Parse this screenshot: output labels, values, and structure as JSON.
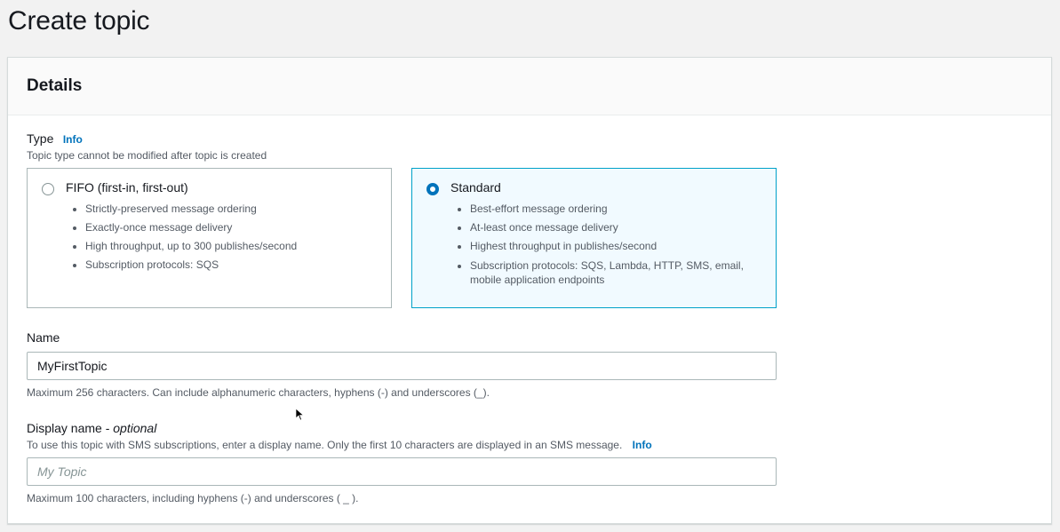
{
  "page": {
    "title": "Create topic"
  },
  "details": {
    "title": "Details",
    "type": {
      "label": "Type",
      "info": "Info",
      "description": "Topic type cannot be modified after topic is created",
      "options": [
        {
          "title": "FIFO (first-in, first-out)",
          "selected": false,
          "bullets": [
            "Strictly-preserved message ordering",
            "Exactly-once message delivery",
            "High throughput, up to 300 publishes/second",
            "Subscription protocols: SQS"
          ]
        },
        {
          "title": "Standard",
          "selected": true,
          "bullets": [
            "Best-effort message ordering",
            "At-least once message delivery",
            "Highest throughput in publishes/second",
            "Subscription protocols: SQS, Lambda, HTTP, SMS, email, mobile application endpoints"
          ]
        }
      ]
    },
    "name": {
      "label": "Name",
      "value": "MyFirstTopic",
      "hint": "Maximum 256 characters. Can include alphanumeric characters, hyphens (-) and underscores (_)."
    },
    "display_name": {
      "label": "Display name - ",
      "label_optional": "optional",
      "description": "To use this topic with SMS subscriptions, enter a display name. Only the first 10 characters are displayed in an SMS message.",
      "info": "Info",
      "placeholder": "My Topic",
      "value": "",
      "hint": "Maximum 100 characters, including hyphens (-) and underscores ( _ )."
    }
  },
  "colors": {
    "accent": "#0073bb",
    "selected_bg": "#f1faff",
    "selected_border": "#00a1c9"
  },
  "icons": {
    "radio_selected": "radio-selected-icon",
    "radio_unselected": "radio-unselected-icon",
    "cursor": "mouse-pointer-icon"
  }
}
